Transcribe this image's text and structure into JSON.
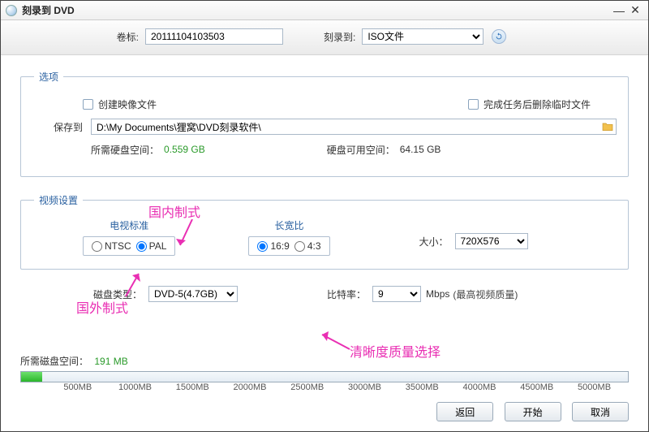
{
  "window": {
    "title": "刻录到 DVD"
  },
  "top": {
    "volume_label_text": "卷标:",
    "volume_value": "20111104103503",
    "burn_to_label": "刻录到:",
    "burn_to_selected": "ISO文件"
  },
  "options": {
    "legend": "选项",
    "create_image_label": "创建映像文件",
    "delete_temp_label": "完成任务后删除临时文件",
    "save_to_label": "保存到",
    "save_to_path": "D:\\My Documents\\狸窝\\DVD刻录软件\\",
    "req_space_label": "所需硬盘空间：",
    "req_space_value": "0.559 GB",
    "free_space_label": "硬盘可用空间：",
    "free_space_value": "64.15 GB"
  },
  "video": {
    "legend": "视频设置",
    "tv_standard_label": "电视标准",
    "ntsc": "NTSC",
    "pal": "PAL",
    "aspect_label": "长宽比",
    "r169": "16:9",
    "r43": "4:3",
    "size_label": "大小：",
    "size_value": "720X576"
  },
  "disc": {
    "disc_type_label": "磁盘类型：",
    "disc_type_value": "DVD-5(4.7GB)",
    "bitrate_label": "比特率：",
    "bitrate_value": "9",
    "bitrate_unit": "Mbps",
    "bitrate_hint": "(最高视频质量)"
  },
  "annotations": {
    "domestic": "国内制式",
    "foreign": "国外制式",
    "clarity": "清晰度质量选择"
  },
  "progress": {
    "disk_space_label": "所需磁盘空间：",
    "disk_space_value": "191 MB",
    "ticks": [
      "500MB",
      "1000MB",
      "1500MB",
      "2000MB",
      "2500MB",
      "3000MB",
      "3500MB",
      "4000MB",
      "4500MB",
      "5000MB"
    ]
  },
  "buttons": {
    "back": "返回",
    "start": "开始",
    "cancel": "取消"
  }
}
